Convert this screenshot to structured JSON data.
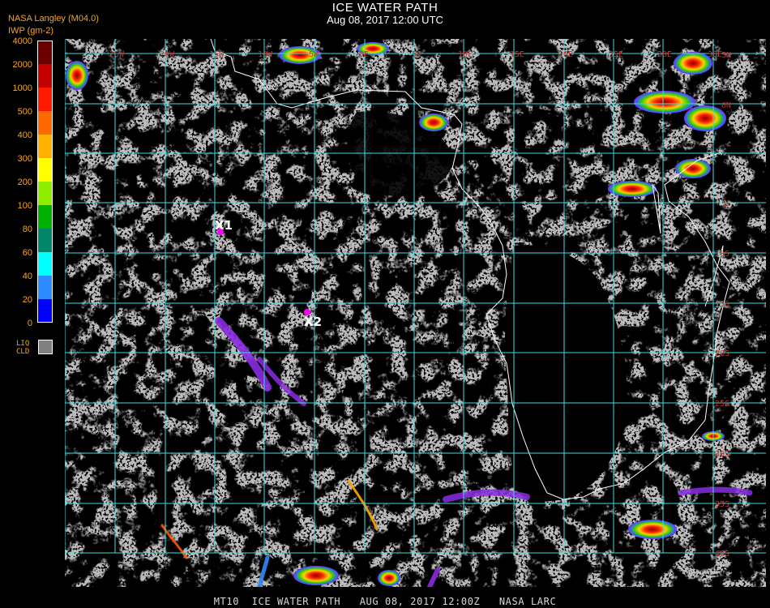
{
  "header": {
    "title": "ICE WATER PATH",
    "subtitle": "Aug 08, 2017 12:00 UTC",
    "source": "NASA Langley (M04.0)",
    "units": "IWP (gm-2)"
  },
  "legend": {
    "levels": [
      {
        "label": "4000",
        "color": "#6b0000"
      },
      {
        "label": "2000",
        "color": "#c40000"
      },
      {
        "label": "1000",
        "color": "#ff1a00"
      },
      {
        "label": "500",
        "color": "#ff6a00"
      },
      {
        "label": "400",
        "color": "#ffb000"
      },
      {
        "label": "300",
        "color": "#ffff00"
      },
      {
        "label": "200",
        "color": "#90ee00"
      },
      {
        "label": "100",
        "color": "#00b000"
      },
      {
        "label": "80",
        "color": "#00876a"
      },
      {
        "label": "60",
        "color": "#00ffff"
      },
      {
        "label": "40",
        "color": "#2c8cff"
      },
      {
        "label": "20",
        "color": "#0000ff"
      },
      {
        "label": "0",
        "color": "#8a2be2"
      }
    ],
    "liquid_label_1": "LIQ",
    "liquid_label_2": "CLD",
    "liquid_color": "#808080"
  },
  "map": {
    "lon_labels": [
      "25W",
      "20W",
      "15W",
      "10W",
      "5W",
      "0E",
      "5E",
      "10E",
      "15E",
      "20E",
      "25E",
      "30E",
      "35E"
    ],
    "lat_labels": [
      "5N",
      "0N",
      "5S",
      "10S",
      "15S",
      "20S",
      "25S",
      "30S",
      "35S",
      "40S"
    ],
    "markers": [
      {
        "label": "X1",
        "color": "#ff00ff"
      },
      {
        "label": "X2",
        "color": "#ff00ff"
      }
    ],
    "grid_color": "#3fdcdc",
    "label_color": "#c8302c",
    "coast_color": "#ffffff",
    "cloud_color": "#808080"
  },
  "footer": {
    "text": "MT10  ICE WATER PATH   AUG 08, 2017 12:00Z   NASA LARC"
  }
}
